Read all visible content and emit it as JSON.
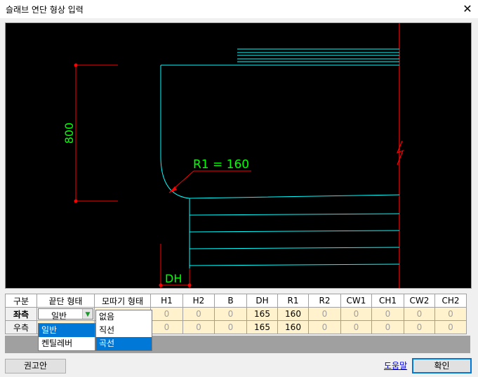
{
  "window": {
    "title": "슬래브 연단 형상 입력",
    "close_glyph": "✕"
  },
  "drawing": {
    "dim_height": "800",
    "radius_label": "R1 = 160",
    "dh_label": "DH",
    "colors": {
      "background": "#000000",
      "cyan": "#00ffff",
      "red": "#ff0000",
      "green": "#00ff00"
    }
  },
  "table": {
    "headers": [
      "구분",
      "끝단 형태",
      "모따기 형태",
      "H1",
      "H2",
      "B",
      "DH",
      "R1",
      "R2",
      "CW1",
      "CH1",
      "CW2",
      "CH2"
    ],
    "rows": [
      {
        "label": "좌측",
        "end_type": "일반",
        "values": [
          "0",
          "0",
          "0",
          "165",
          "160",
          "0",
          "0",
          "0",
          "0",
          "0"
        ]
      },
      {
        "label": "우측",
        "values": [
          "0",
          "0",
          "0",
          "165",
          "160",
          "0",
          "0",
          "0",
          "0",
          "0"
        ]
      }
    ]
  },
  "end_type_dropdown": {
    "options": [
      "일반",
      "켄틸레버"
    ],
    "selected": "일반"
  },
  "chamfer_dropdown": {
    "options": [
      "없음",
      "직선",
      "곡선"
    ],
    "selected": "곡선"
  },
  "buttons": {
    "recommend": "권고안",
    "help": "도움말",
    "ok": "확인"
  }
}
